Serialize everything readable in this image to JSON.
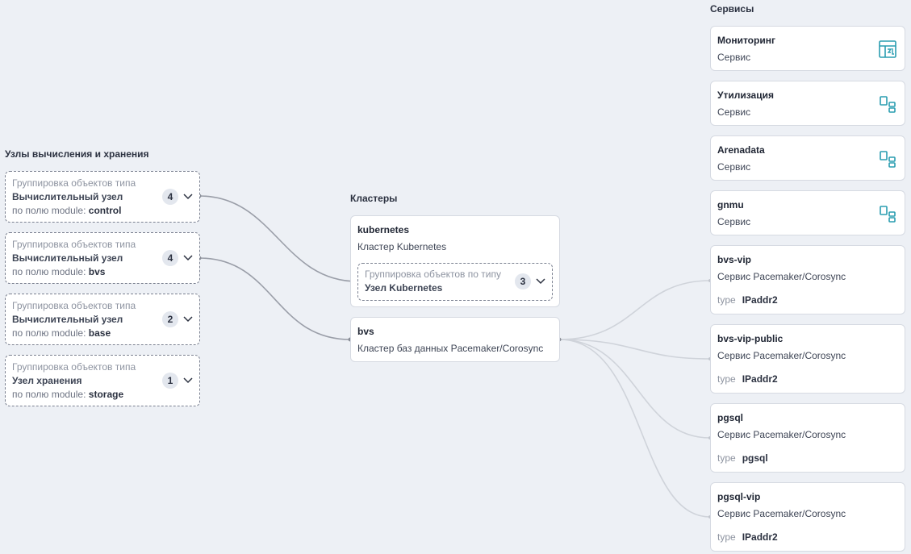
{
  "columns": {
    "nodes_title": "Узлы вычисления и хранения",
    "clusters_title": "Кластеры",
    "services_title": "Сервисы"
  },
  "node_groups": [
    {
      "line1": "Группировка объектов типа",
      "type": "Вычислительный узел",
      "field_prefix": "по полю module:",
      "field_value": "control",
      "count": "4"
    },
    {
      "line1": "Группировка объектов типа",
      "type": "Вычислительный узел",
      "field_prefix": "по полю module:",
      "field_value": "bvs",
      "count": "4"
    },
    {
      "line1": "Группировка объектов типа",
      "type": "Вычислительный узел",
      "field_prefix": "по полю module:",
      "field_value": "base",
      "count": "2"
    },
    {
      "line1": "Группировка объектов типа",
      "type": "Узел хранения",
      "field_prefix": "по полю module:",
      "field_value": "storage",
      "count": "1"
    }
  ],
  "clusters": [
    {
      "name": "kubernetes",
      "subtitle": "Кластер Kubernetes",
      "inner_group": {
        "line1": "Группировка объектов по типу",
        "type": "Узел Kubernetes",
        "count": "3"
      }
    },
    {
      "name": "bvs",
      "subtitle": "Кластер баз данных Pacemaker/Corosync"
    }
  ],
  "services": [
    {
      "name": "Мониторинг",
      "subtitle": "Сервис",
      "icon": "dashboard-icon"
    },
    {
      "name": "Утилизация",
      "subtitle": "Сервис",
      "icon": "widgets-icon"
    },
    {
      "name": "Arenadata",
      "subtitle": "Сервис",
      "icon": "widgets-icon"
    },
    {
      "name": "gnmu",
      "subtitle": "Сервис",
      "icon": "widgets-icon"
    },
    {
      "name": "bvs-vip",
      "subtitle": "Сервис Pacemaker/Corosync",
      "meta_key": "type",
      "meta_value": "IPaddr2"
    },
    {
      "name": "bvs-vip-public",
      "subtitle": "Сервис Pacemaker/Corosync",
      "meta_key": "type",
      "meta_value": "IPaddr2"
    },
    {
      "name": "pgsql",
      "subtitle": "Сервис Pacemaker/Corosync",
      "meta_key": "type",
      "meta_value": "pgsql"
    },
    {
      "name": "pgsql-vip",
      "subtitle": "Сервис Pacemaker/Corosync",
      "meta_key": "type",
      "meta_value": "IPaddr2"
    }
  ],
  "colors": {
    "background": "#edf0f5",
    "edge_dark": "#9a9ea8",
    "edge_light": "#cfd3da",
    "icon_teal": "#2a9db0"
  }
}
